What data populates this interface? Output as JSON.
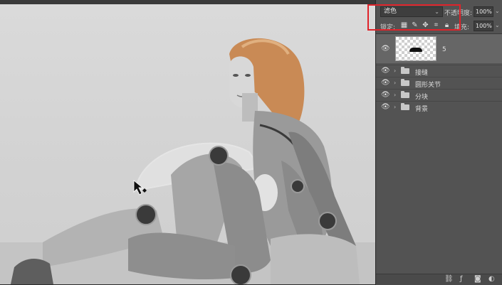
{
  "layers_panel": {
    "blend_mode": "滤色",
    "blend_chevron": "⌄",
    "opacity_label": "不透明度:",
    "opacity_value": "100%",
    "lock_label": "锁定:",
    "fill_label": "填充:",
    "fill_value": "100%",
    "chevron": "⌄",
    "lock_icons": [
      "checker-lock-icon",
      "brush-lock-icon",
      "move-lock-icon",
      "artboard-lock-icon",
      "padlock-icon"
    ],
    "selected_layer": {
      "name": "5",
      "eye": "👁"
    },
    "groups": [
      {
        "name": "接缝",
        "eye": "👁",
        "arrow": "›"
      },
      {
        "name": "圆形关节",
        "eye": "👁",
        "arrow": "›"
      },
      {
        "name": "分块",
        "eye": "👁",
        "arrow": "›"
      },
      {
        "name": "背景",
        "eye": "👁",
        "arrow": "›"
      }
    ],
    "bottom_icons": [
      "link-icon",
      "fx-icon",
      "mask-icon",
      "adjustment-icon"
    ]
  },
  "highlight_color": "#e0232a"
}
